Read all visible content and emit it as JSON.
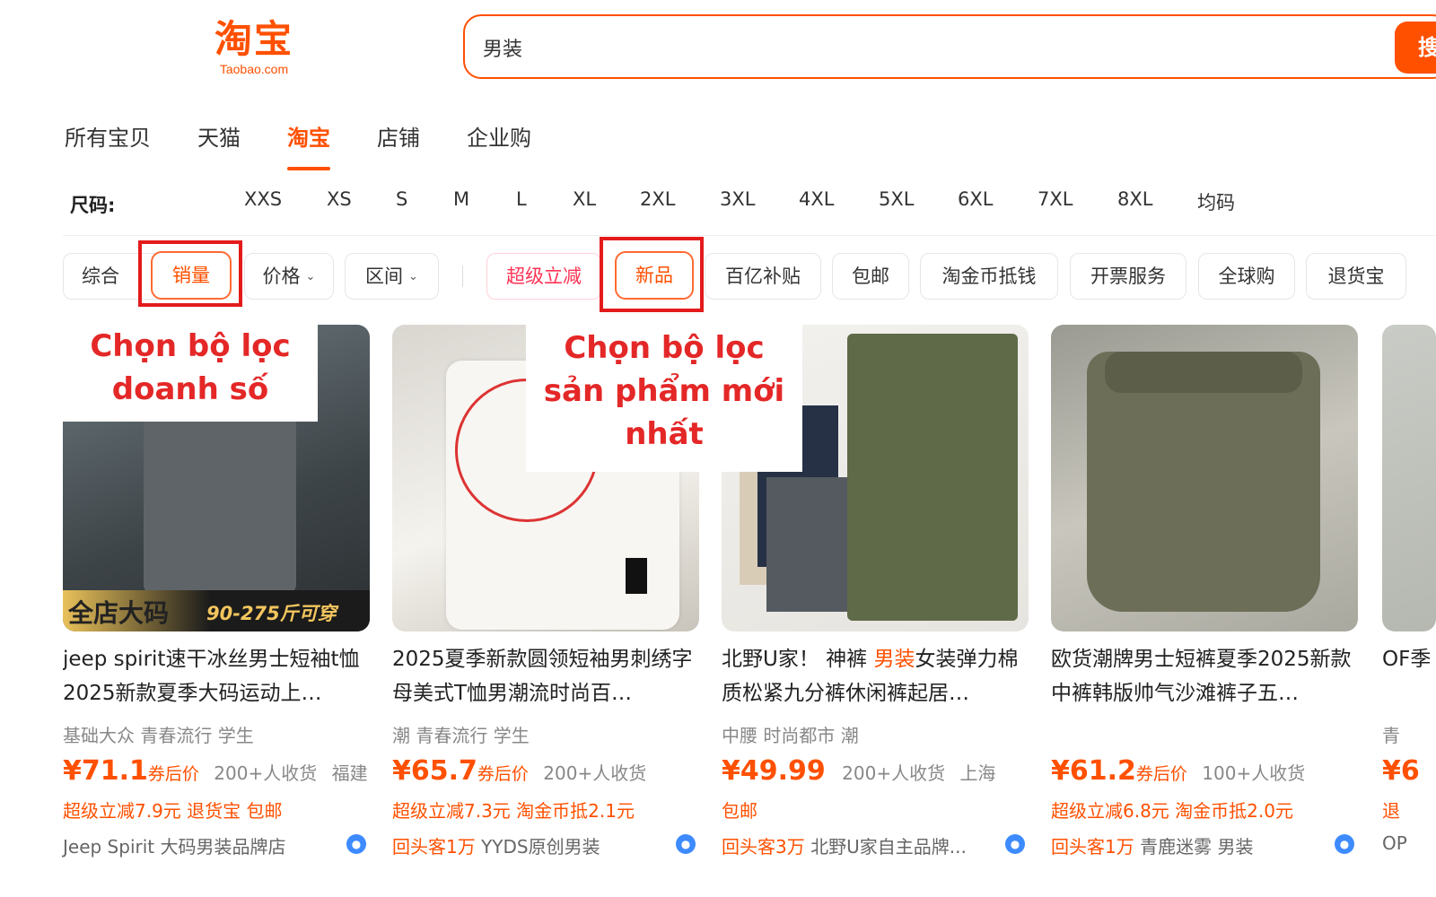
{
  "logo": {
    "cn": "淘宝",
    "en": "Taobao.com"
  },
  "search": {
    "value": "男装",
    "button": "搜"
  },
  "tabs": [
    {
      "label": "所有宝贝"
    },
    {
      "label": "天猫"
    },
    {
      "label": "淘宝",
      "active": true
    },
    {
      "label": "店铺"
    },
    {
      "label": "企业购"
    }
  ],
  "sizes": {
    "label": "尺码:",
    "items": [
      "XXS",
      "XS",
      "S",
      "M",
      "L",
      "XL",
      "2XL",
      "3XL",
      "4XL",
      "5XL",
      "6XL",
      "7XL",
      "8XL",
      "均码"
    ]
  },
  "filters": {
    "zonghe": "综合",
    "xiaoliang": "销量",
    "jiage": "价格",
    "qujian": "区间",
    "chaoji": "超级立减",
    "xinpin": "新品",
    "baiyi": "百亿补贴",
    "baoyou": "包邮",
    "taojinbi": "淘金币抵钱",
    "kaipiao": "开票服务",
    "quanqiu": "全球购",
    "tuihuo": "退货宝"
  },
  "annotations": {
    "sales": [
      "Chọn bộ lọc",
      "doanh số"
    ],
    "newest": [
      "Chọn bộ lọc",
      "sản phẩm mới",
      "nhất"
    ]
  },
  "products": [
    {
      "title": "jeep spirit速干冰丝男士短袖t恤2025新款夏季大码运动上…",
      "banner": "全店大码",
      "banner_sub": "90-275斤可穿",
      "tags": "基础大众  青春流行  学生",
      "price": "¥71.1",
      "price_suffix": "券后价",
      "sold": "200+人收货",
      "location": "福建",
      "promo": "超级立减7.9元  退货宝  包邮",
      "shop_prefix": "",
      "shop": "Jeep Spirit 大码男装品牌店"
    },
    {
      "title": "2025夏季新款圆领短袖男刺绣字母美式T恤男潮流时尚百…",
      "tags": "潮  青春流行  学生",
      "price": "¥65.7",
      "price_suffix": "券后价",
      "sold": "200+人收货",
      "location": "",
      "promo": "超级立减7.3元  淘金币抵2.1元",
      "shop_prefix": "回头客1万",
      "shop": " YYDS原创男装"
    },
    {
      "title_a": "北野U家！ 神裤 ",
      "title_hl": "男装",
      "title_b": "女装弹力棉质松紧九分裤休闲裤起居…",
      "tags": "中腰  时尚都市  潮",
      "price": "¥49.99",
      "price_suffix": "",
      "sold": "200+人收货",
      "location": "上海",
      "promo": "包邮",
      "shop_prefix": "回头客3万",
      "shop": " 北野U家自主品牌..."
    },
    {
      "title": "欧货潮牌男士短裤夏季2025新款中裤韩版帅气沙滩裤子五…",
      "tags": "",
      "price": "¥61.2",
      "price_suffix": "券后价",
      "sold": "100+人收货",
      "location": "",
      "promo": "超级立减6.8元  淘金币抵2.0元",
      "shop_prefix": "回头客1万",
      "shop": " 青鹿迷雾 男装"
    },
    {
      "title": "OF季",
      "tags": "青",
      "price": "¥6",
      "promo": "退",
      "shop": "OP"
    }
  ],
  "colors": {
    "accent": "#ff5000",
    "annotation": "#e42727"
  }
}
